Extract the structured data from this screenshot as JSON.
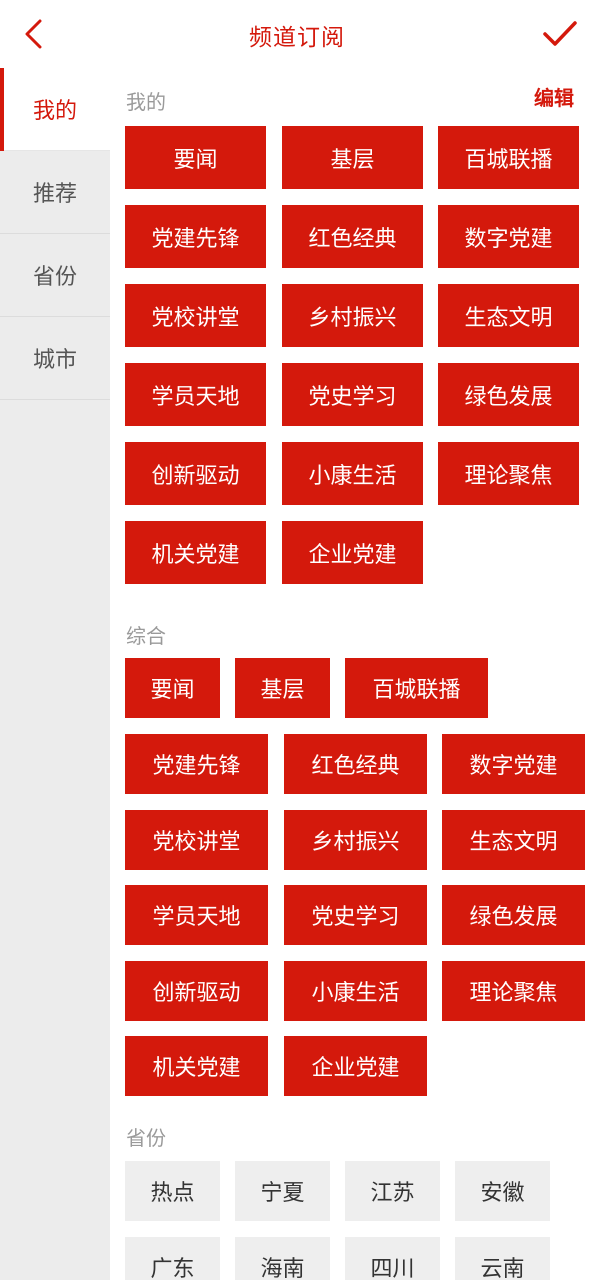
{
  "header": {
    "title": "频道订阅",
    "back_icon": "chevron-left-icon",
    "confirm_icon": "checkmark-icon"
  },
  "sidebar": {
    "items": [
      "我的",
      "推荐",
      "省份",
      "城市"
    ],
    "active_index": 0
  },
  "mine": {
    "title": "我的",
    "edit_label": "编辑",
    "channels": [
      "要闻",
      "基层",
      "百城联播",
      "党建先锋",
      "红色经典",
      "数字党建",
      "党校讲堂",
      "乡村振兴",
      "生态文明",
      "学员天地",
      "党史学习",
      "绿色发展",
      "创新驱动",
      "小康生活",
      "理论聚焦",
      "机关党建",
      "企业党建"
    ]
  },
  "general": {
    "title": "综合",
    "channels": [
      "要闻",
      "基层",
      "百城联播",
      "党建先锋",
      "红色经典",
      "数字党建",
      "党校讲堂",
      "乡村振兴",
      "生态文明",
      "学员天地",
      "党史学习",
      "绿色发展",
      "创新驱动",
      "小康生活",
      "理论聚焦",
      "机关党建",
      "企业党建"
    ]
  },
  "province": {
    "title": "省份",
    "channels": [
      "热点",
      "宁夏",
      "江苏",
      "安徽",
      "广东",
      "海南",
      "四川",
      "云南"
    ]
  },
  "colors": {
    "accent": "#d4190c",
    "chip_gray": "#eeeeee",
    "sidebar_bg": "#ececec"
  }
}
